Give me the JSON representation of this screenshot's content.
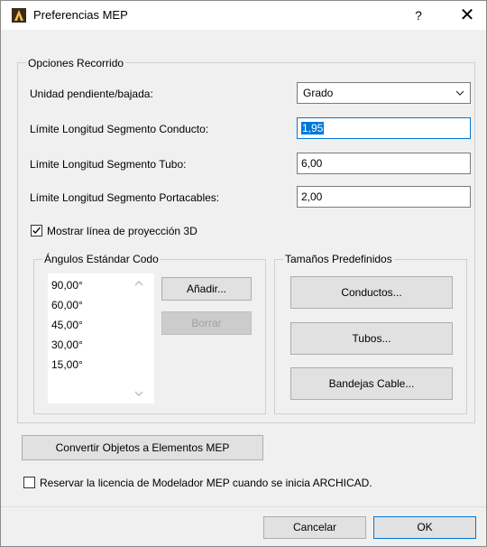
{
  "window": {
    "title": "Preferencias MEP",
    "help_glyph": "?",
    "close_glyph": "✕"
  },
  "routing": {
    "legend": "Opciones Recorrido",
    "slope_label": "Unidad pendiente/bajada:",
    "slope_value": "Grado",
    "duct_label": "Límite Longitud Segmento Conducto:",
    "duct_value": "1,95",
    "pipe_label": "Límite Longitud Segmento Tubo:",
    "pipe_value": "6,00",
    "cable_label": "Límite Longitud Segmento Portacables:",
    "cable_value": "2,00",
    "show3d_label": "Mostrar línea de proyección 3D",
    "show3d_checked": true
  },
  "elbows": {
    "legend": "Ángulos Estándar Codo",
    "items": [
      "90,00°",
      "60,00°",
      "45,00°",
      "30,00°",
      "15,00°"
    ],
    "add_label": "Añadir...",
    "delete_label": "Borrar"
  },
  "sizes": {
    "legend": "Tamaños Predefinidos",
    "ducts_label": "Conductos...",
    "pipes_label": "Tubos...",
    "trays_label": "Bandejas Cable..."
  },
  "convert_label": "Convertir Objetos a Elementos MEP",
  "reserve_license_label": "Reservar la licencia de Modelador MEP cuando se inicia ARCHICAD.",
  "reserve_license_checked": false,
  "footer": {
    "cancel_label": "Cancelar",
    "ok_label": "OK"
  },
  "icons": {
    "app": "archicad-logo-icon",
    "dropdown": "chevron-down-icon",
    "scroll_up": "chevron-up-icon",
    "scroll_down": "chevron-down-icon"
  },
  "colors": {
    "accent": "#0078d7",
    "dialog_bg": "#f0f0f0",
    "button_bg": "#e1e1e1"
  }
}
